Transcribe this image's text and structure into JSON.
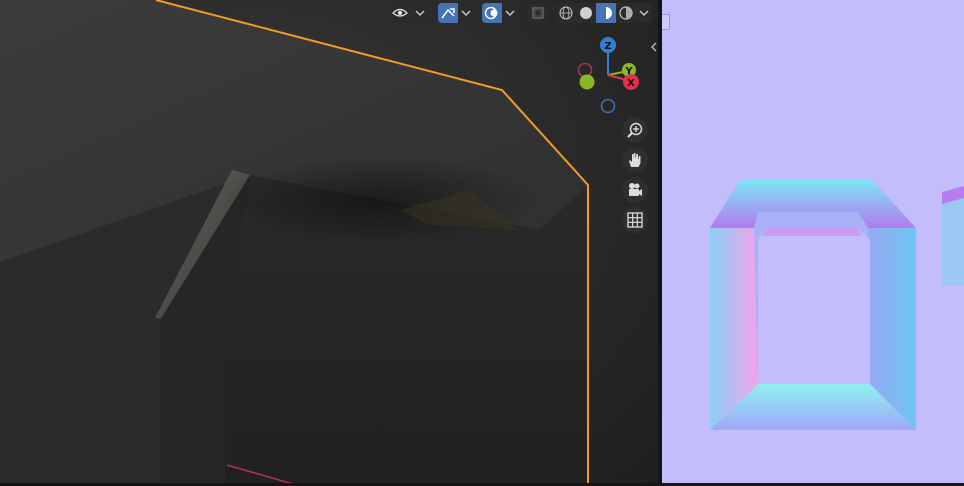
{
  "viewport_header": {
    "visibility_icon": "eye-icon",
    "gizmo_toggle_icon": "gizmo-icon",
    "overlay_icon": "overlay-icon",
    "xray_icon": "xray-icon",
    "shading_modes": [
      "wireframe",
      "solid",
      "material-preview",
      "rendered"
    ],
    "active_shading": "material-preview"
  },
  "nav_gizmo": {
    "z_label": "Z",
    "y_label": "Y",
    "x_label": "X",
    "colors": {
      "z": "#2f80d6",
      "y": "#8ab727",
      "x": "#e0324f",
      "outline": "#4a7bd1"
    }
  },
  "nav_buttons": [
    "zoom-icon",
    "pan-hand-icon",
    "camera-icon",
    "grid-perspective-icon"
  ],
  "colors": {
    "selection_outline": "#f39a2a",
    "image_background": "#c3bcfd"
  }
}
